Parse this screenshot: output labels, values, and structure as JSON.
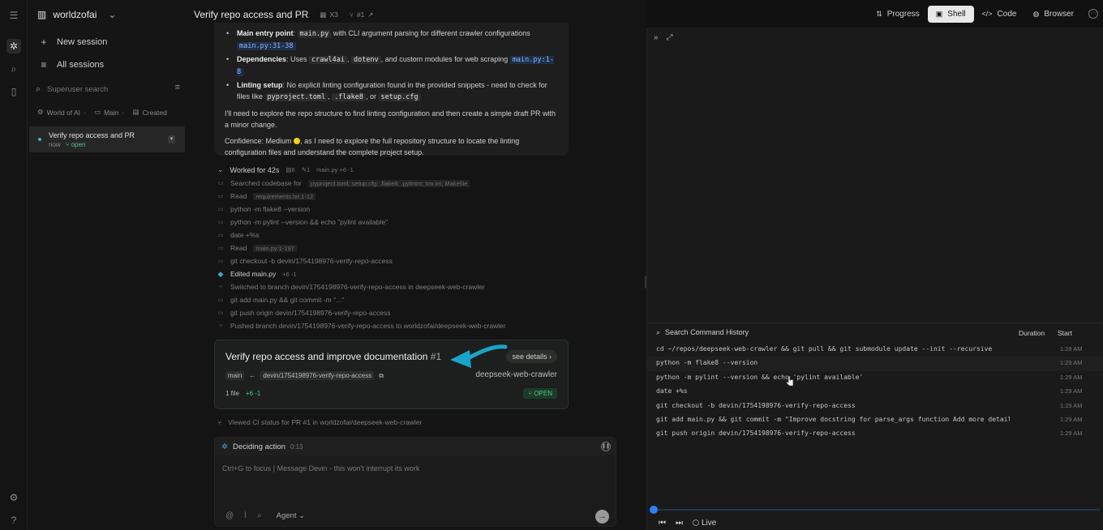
{
  "workspace": {
    "name": "worldzofai"
  },
  "sidebar": {
    "new_session": "New session",
    "all_sessions": "All sessions",
    "search_placeholder": "Superuser search",
    "chips": [
      "World of AI",
      "Main",
      "Created"
    ],
    "session": {
      "title": "Verify repo access and PR",
      "time": "now",
      "status": "open"
    }
  },
  "chat": {
    "title": "Verify repo access and PR",
    "meta_x": "X3",
    "meta_pr": "#1",
    "bullets": [
      {
        "label": "Main entry point",
        "text": ": ",
        "code": "main.py",
        "text2": " with CLI argument parsing for different crawler configurations ",
        "ref": "main.py:31-38"
      },
      {
        "label": "Dependencies",
        "text": ": Uses ",
        "codes": [
          "crawl4ai",
          "dotenv"
        ],
        "text2": ", and custom modules for web scraping ",
        "ref": "main.py:1-8"
      },
      {
        "label": "Linting setup",
        "text": ": No explicit linting configuration found in the provided snippets - need to check for files like ",
        "codes": [
          "pyproject.toml",
          ".flake8",
          "setup.cfg"
        ]
      }
    ],
    "para1": "I'll need to explore the repo structure to find linting configuration and then create a simple draft PR with a minor change.",
    "confidence_label": "Confidence: Medium",
    "confidence_rest": ", as I need to explore the full repository structure to locate the linting configuration files and understand the complete project setup.",
    "worked": {
      "label": "Worked for 42s",
      "m1": "6",
      "m2": "1",
      "file": "main.py",
      "diff": "+6 -1"
    },
    "steps": [
      {
        "icon": "search",
        "text": "Searched codebase for",
        "tag": "pyproject.toml; setup.cfg; .flake8; .pylintrc; tox.ini; Makefile"
      },
      {
        "icon": "folder",
        "text": "Read",
        "tag": "requirements.txt:1-12"
      },
      {
        "icon": "terminal",
        "text": "python -m flake8 --version"
      },
      {
        "icon": "terminal",
        "text": "python -m pylint --version && echo \"pylint available\""
      },
      {
        "icon": "terminal",
        "text": "date +%s"
      },
      {
        "icon": "folder",
        "text": "Read",
        "tag": "main.py:1-197"
      },
      {
        "icon": "terminal",
        "text": "git checkout -b devin/1754198976-verify-repo-access"
      },
      {
        "icon": "edit",
        "text": "Edited main.py",
        "diff": "+6 -1"
      },
      {
        "icon": "branch",
        "text": "Switched to branch devin/1754198976-verify-repo-access in deepseek-web-crawler"
      },
      {
        "icon": "terminal",
        "text": "git add main.py && git commit -m \"...\""
      },
      {
        "icon": "terminal",
        "text": "git push origin devin/1754198976-verify-repo-access"
      },
      {
        "icon": "branch",
        "text": "Pushed branch devin/1754198976-verify-repo-access to worldzofai/deepseek-web-crawler"
      }
    ],
    "pr": {
      "title": "Verify repo access and improve documentation",
      "number": "#1",
      "see_details": "see details",
      "base": "main",
      "head": "devin/1754198976-verify-repo-access",
      "repo": "deepseek-web-crawler",
      "files": "1 file",
      "diff": "+6 -1",
      "status": "OPEN"
    },
    "ci_text": "Viewed CI status for PR #1 in worldzofai/deepseek-web-crawler",
    "deciding": "Deciding action",
    "deciding_time": "0:13",
    "composer_placeholder": "Ctrl+G to focus | Message Devin - this won't interrupt its work",
    "agent_label": "Agent"
  },
  "tabs": [
    {
      "label": "Progress",
      "icon": "progress-icon"
    },
    {
      "label": "Shell",
      "icon": "shell-icon",
      "active": true
    },
    {
      "label": "Code",
      "icon": "code-icon"
    },
    {
      "label": "Browser",
      "icon": "globe-icon"
    }
  ],
  "shell": {
    "search_label": "Search Command History",
    "col_duration": "Duration",
    "col_start": "Start",
    "history": [
      {
        "cmd": "cd ~/repos/deepseek-web-crawler && git pull && git submodule update --init --recursive",
        "start": "1:28 AM"
      },
      {
        "cmd": "python -m flake8 --version",
        "start": "1:29 AM"
      },
      {
        "cmd": "python -m pylint --version && echo 'pylint available'",
        "start": "1:29 AM"
      },
      {
        "cmd": "date +%s",
        "start": "1:29 AM"
      },
      {
        "cmd": "git checkout -b devin/1754198976-verify-repo-access",
        "start": "1:29 AM"
      },
      {
        "cmd": "git add main.py && git commit -m \"Improve docstring for parse_args function Add more detail",
        "start": "1:29 AM"
      },
      {
        "cmd": "git push origin devin/1754198976-verify-repo-access",
        "start": "1:29 AM"
      }
    ],
    "live": "Live"
  },
  "colors": {
    "accent": "#2f80ff",
    "open_green": "#4fc987",
    "arrow": "#1aa3c8"
  }
}
